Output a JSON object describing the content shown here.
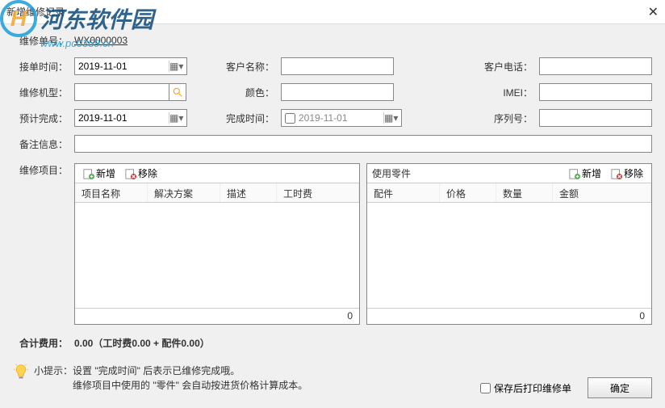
{
  "window": {
    "title": "新增维修记录"
  },
  "watermark": {
    "brand": "河东软件园",
    "url": "www.pc0359.cn",
    "logo_letter": "H"
  },
  "order": {
    "label": "维修单号：",
    "value": "WX0000003"
  },
  "fields": {
    "receive_time": {
      "label": "接单时间：",
      "value": "2019-11-01"
    },
    "customer_name": {
      "label": "客户名称：",
      "value": ""
    },
    "customer_phone": {
      "label": "客户电话：",
      "value": ""
    },
    "repair_model": {
      "label": "维修机型：",
      "value": ""
    },
    "color": {
      "label": "颜色：",
      "value": ""
    },
    "imei": {
      "label": "IMEI：",
      "value": ""
    },
    "expect_done": {
      "label": "预计完成：",
      "value": "2019-11-01"
    },
    "done_time": {
      "label": "完成时间：",
      "value": "2019-11-01",
      "checked": false
    },
    "serial": {
      "label": "序列号：",
      "value": ""
    },
    "note": {
      "label": "备注信息：",
      "value": ""
    },
    "items": {
      "label": "维修项目："
    }
  },
  "left_panel": {
    "add": "新增",
    "remove": "移除",
    "cols": [
      "项目名称",
      "解决方案",
      "描述",
      "工时费"
    ],
    "footer": "0"
  },
  "right_panel": {
    "title": "使用零件",
    "add": "新增",
    "remove": "移除",
    "cols": [
      "配件",
      "价格",
      "数量",
      "金额"
    ],
    "footer": "0"
  },
  "total": {
    "label": "合计费用：",
    "value": "0.00（工时费0.00 + 配件0.00）"
  },
  "tip": {
    "prefix": "小提示：",
    "line1": "设置 \"完成时间\" 后表示已维修完成哦。",
    "line2": "维修项目中使用的 \"零件\" 会自动按进货价格计算成本。"
  },
  "bottom": {
    "print_checkbox": "保存后打印维修单",
    "ok": "确定"
  }
}
